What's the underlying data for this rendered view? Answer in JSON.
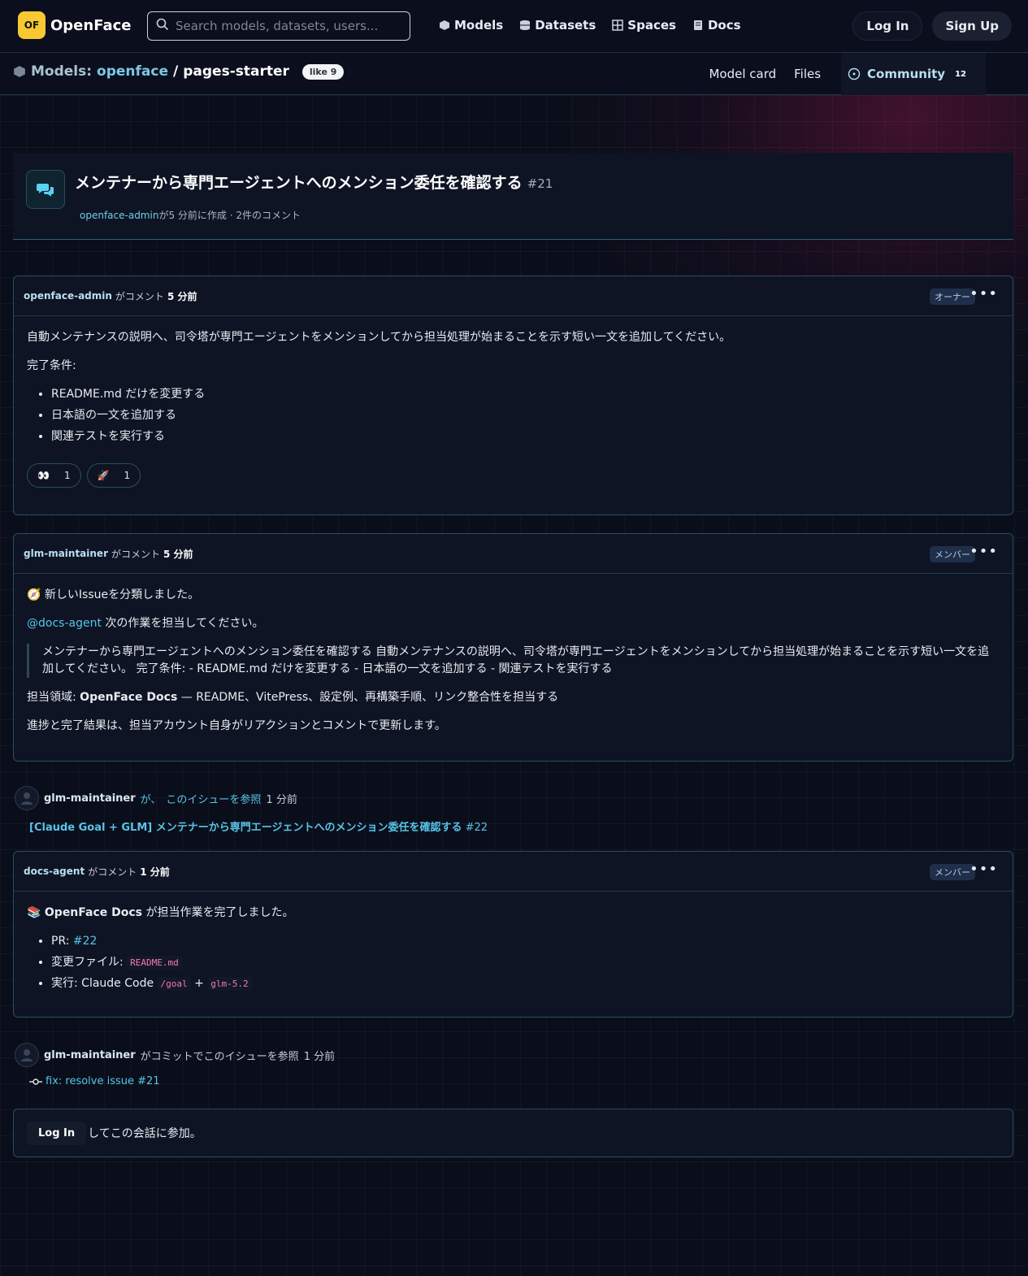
{
  "brand": {
    "mark": "OF",
    "name": "OpenFace"
  },
  "search": {
    "placeholder": "Search models, datasets, users..."
  },
  "nav": [
    "Models",
    "Datasets",
    "Spaces",
    "Docs"
  ],
  "auth": {
    "login": "Log In",
    "signup": "Sign Up"
  },
  "breadcrumb": {
    "section": "Models:",
    "org": "openface",
    "sep": "/",
    "repo": "pages-starter",
    "like": "like 9"
  },
  "tabs": {
    "model_card": "Model card",
    "files": "Files",
    "community": "Community",
    "community_count": "12"
  },
  "issue": {
    "title": "メンテナーから専門エージェントへのメンション委任を確認する",
    "number": "#21",
    "author": "openface-admin",
    "meta": "が5 分前に作成 · 2件のコメント"
  },
  "comments": [
    {
      "author": "openface-admin",
      "verb": "がコメント",
      "time": "5 分前",
      "role": "オーナー",
      "intro": "自動メンテナンスの説明へ、司令塔が専門エージェントをメンションしてから担当処理が始まることを示す短い一文を追加してください。",
      "criteria_label": "完了条件:",
      "items": [
        "README.md だけを変更する",
        "日本語の一文を追加する",
        "関連テストを実行する"
      ],
      "reactions": [
        {
          "emoji": "👀",
          "count": "1"
        },
        {
          "emoji": "🚀",
          "count": "1"
        }
      ]
    },
    {
      "author": "glm-maintainer",
      "verb": "がコメント",
      "time": "5 分前",
      "role": "メンバー",
      "emoji": "🧭",
      "line1": "新しいIssueを分類しました。",
      "mention": "@docs-agent",
      "mention_text": " 次の作業を担当してください。",
      "quote": "メンテナーから専門エージェントへのメンション委任を確認する 自動メンテナンスの説明へ、司令塔が専門エージェントをメンションしてから担当処理が始まることを示す短い一文を追加してください。 完了条件: - README.md だけを変更する - 日本語の一文を追加する - 関連テストを実行する",
      "domain_label": "担当領域: ",
      "domain_name": "OpenFace Docs",
      "domain_desc": " — README、VitePress、設定例、再構築手順、リンク整合性を担当する",
      "progress": "進捗と完了結果は、担当アカウント自身がリアクションとコメントで更新します。"
    },
    {
      "author": "docs-agent",
      "verb": "がコメント",
      "time": "1 分前",
      "role": "メンバー",
      "emoji": "📚",
      "name": "OpenFace Docs",
      "done": " が担当作業を完了しました。",
      "pr_label": "PR: ",
      "pr": "#22",
      "files_label": "変更ファイル: ",
      "file": "README.md",
      "run_label": "実行: Claude Code ",
      "cmd1": "/goal",
      "plus": " + ",
      "cmd2": "glm-5.2"
    }
  ],
  "events": [
    {
      "user": "glm-maintainer",
      "text": " が、",
      "link": "このイシューを参照",
      "time": " 1 分前",
      "ref_title": "[Claude Goal + GLM] メンテナーから専門エージェントへのメンション委任を確認する",
      "ref_num": "#22"
    },
    {
      "user": "glm-maintainer",
      "text": " がコミットでこのイシューを参照",
      "time": " 1 分前",
      "commit": "fix: resolve issue #21"
    }
  ],
  "login_prompt": {
    "button": "Log In",
    "text": "してこの会話に参加。"
  }
}
